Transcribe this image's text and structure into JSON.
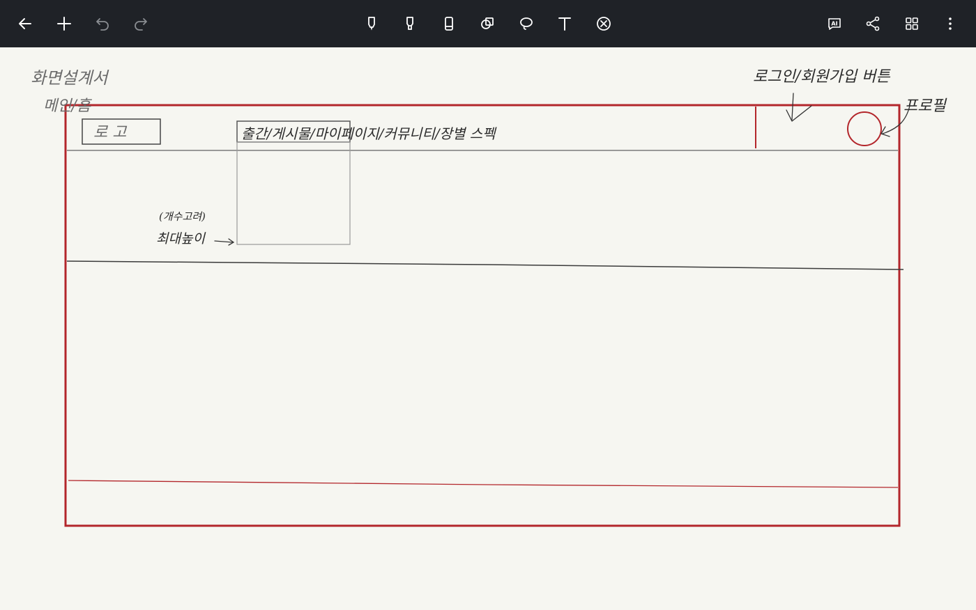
{
  "toolbar": {
    "left": [
      {
        "name": "back-button",
        "icon": "arrow-left-icon"
      },
      {
        "name": "add-page-button",
        "icon": "plus-icon"
      },
      {
        "name": "undo-button",
        "icon": "undo-icon"
      },
      {
        "name": "redo-button",
        "icon": "redo-icon"
      }
    ],
    "tools": [
      {
        "name": "pen-tool",
        "icon": "pen-icon",
        "selected": true
      },
      {
        "name": "highlighter-tool",
        "icon": "highlighter-icon"
      },
      {
        "name": "eraser-tool",
        "icon": "eraser-icon"
      },
      {
        "name": "shape-tool",
        "icon": "shapes-icon"
      },
      {
        "name": "lasso-tool",
        "icon": "lasso-icon"
      },
      {
        "name": "text-tool",
        "icon": "text-icon"
      },
      {
        "name": "stylus-only-tool",
        "icon": "cancel-circle-icon"
      }
    ],
    "right": [
      {
        "name": "ai-button",
        "icon": "ai-icon",
        "label": "AI"
      },
      {
        "name": "share-button",
        "icon": "share-icon"
      },
      {
        "name": "page-grid-button",
        "icon": "grid-icon"
      },
      {
        "name": "more-menu-button",
        "icon": "more-vertical-icon"
      }
    ]
  },
  "colors": {
    "toolbar_bg": "#1f2227",
    "icon": "#ffffff",
    "icon_disabled": "#8a8d92",
    "paper": "#f6f6f1",
    "ink_red": "#b3262b",
    "ink_dark": "#3a3a3a",
    "ink_gray": "#9a9a9a"
  },
  "notes": {
    "screen_design": "화면설계서",
    "main_home": "메인/홈",
    "logo": "로 고",
    "nav_menu": "출간/게시물/마이페이지/커뮤니티/장별 스펙",
    "login_signup": "로그인/회원가입 버튼",
    "profile": "프로필",
    "count_note": "(개수고려)",
    "max_height": "최대높이"
  }
}
